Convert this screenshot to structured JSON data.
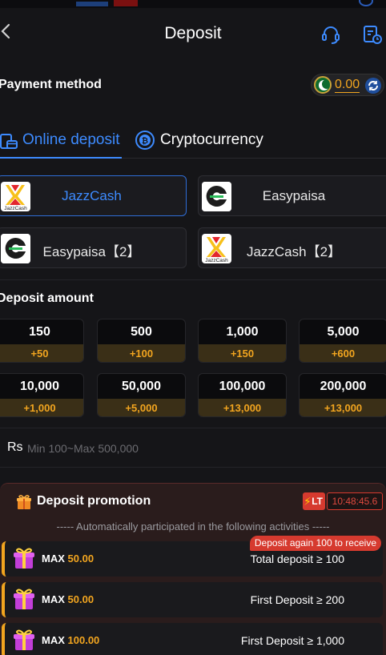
{
  "header": {
    "title": "Deposit"
  },
  "payment": {
    "label": "Payment method",
    "balance": "0.00"
  },
  "tabs": [
    {
      "label": "Online deposit",
      "active": true
    },
    {
      "label": "Cryptocurrency",
      "active": false
    }
  ],
  "methods": [
    {
      "label": "JazzCash",
      "logo_text": "JazzCash",
      "selected": true
    },
    {
      "label": "Easypaisa",
      "logo_text": "",
      "selected": false
    },
    {
      "label": "Easypaisa【2】",
      "logo_text": "",
      "selected": false
    },
    {
      "label": "JazzCash【2】",
      "logo_text": "JazzCash",
      "selected": false
    }
  ],
  "deposit_amount": {
    "label": "Deposit amount",
    "options": [
      {
        "amount": "150",
        "bonus": "+50"
      },
      {
        "amount": "500",
        "bonus": "+100"
      },
      {
        "amount": "1,000",
        "bonus": "+150"
      },
      {
        "amount": "5,000",
        "bonus": "+600"
      },
      {
        "amount": "10,000",
        "bonus": "+1,000"
      },
      {
        "amount": "50,000",
        "bonus": "+5,000"
      },
      {
        "amount": "100,000",
        "bonus": "+13,000"
      },
      {
        "amount": "200,000",
        "bonus": "+13,000"
      }
    ],
    "currency": "Rs",
    "placeholder": "Min 100~Max 500,000"
  },
  "promotion": {
    "title": "Deposit promotion",
    "badge": "LT",
    "timer": "10:48:45.6",
    "note": "----- Automatically participated in the following activities -----",
    "items": [
      {
        "max_label": "MAX",
        "max_value": "50.00",
        "condition": "Total deposit ≥ 100",
        "tag": "Deposit again 100 to receive"
      },
      {
        "max_label": "MAX",
        "max_value": "50.00",
        "condition": "First Deposit ≥ 200"
      },
      {
        "max_label": "MAX",
        "max_value": "100.00",
        "condition": "First Deposit ≥ 1,000"
      }
    ]
  },
  "colors": {
    "accent_blue": "#3d8bff",
    "accent_gold": "#f2a51f",
    "alert_red": "#d63a2f",
    "background": "#151518"
  }
}
